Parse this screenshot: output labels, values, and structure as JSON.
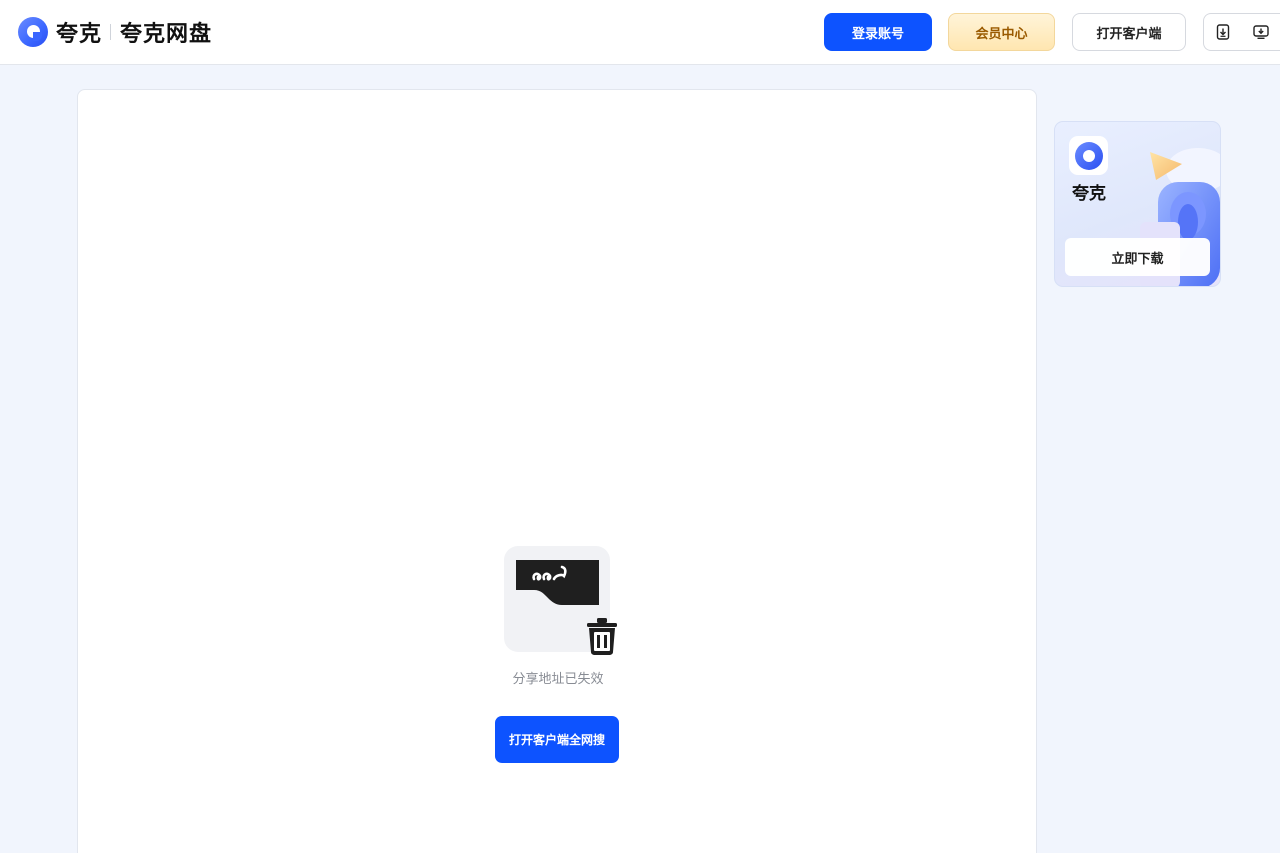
{
  "header": {
    "brand": "夸克",
    "product": "夸克网盘",
    "login_label": "登录账号",
    "vip_label": "会员中心",
    "open_client_label": "打开客户端",
    "icons": [
      "download-app-icon",
      "desktop-client-icon"
    ]
  },
  "main": {
    "illustration": "broken-link-trash-icon",
    "message": "分享地址已失效",
    "open_all_label": "打开客户端全网搜"
  },
  "side_ad": {
    "brand": "夸克",
    "download_label": "立即下载"
  },
  "colors": {
    "primary": "#0d53ff",
    "vip_text": "#9a5a00",
    "page_bg": "#f1f5fd"
  }
}
